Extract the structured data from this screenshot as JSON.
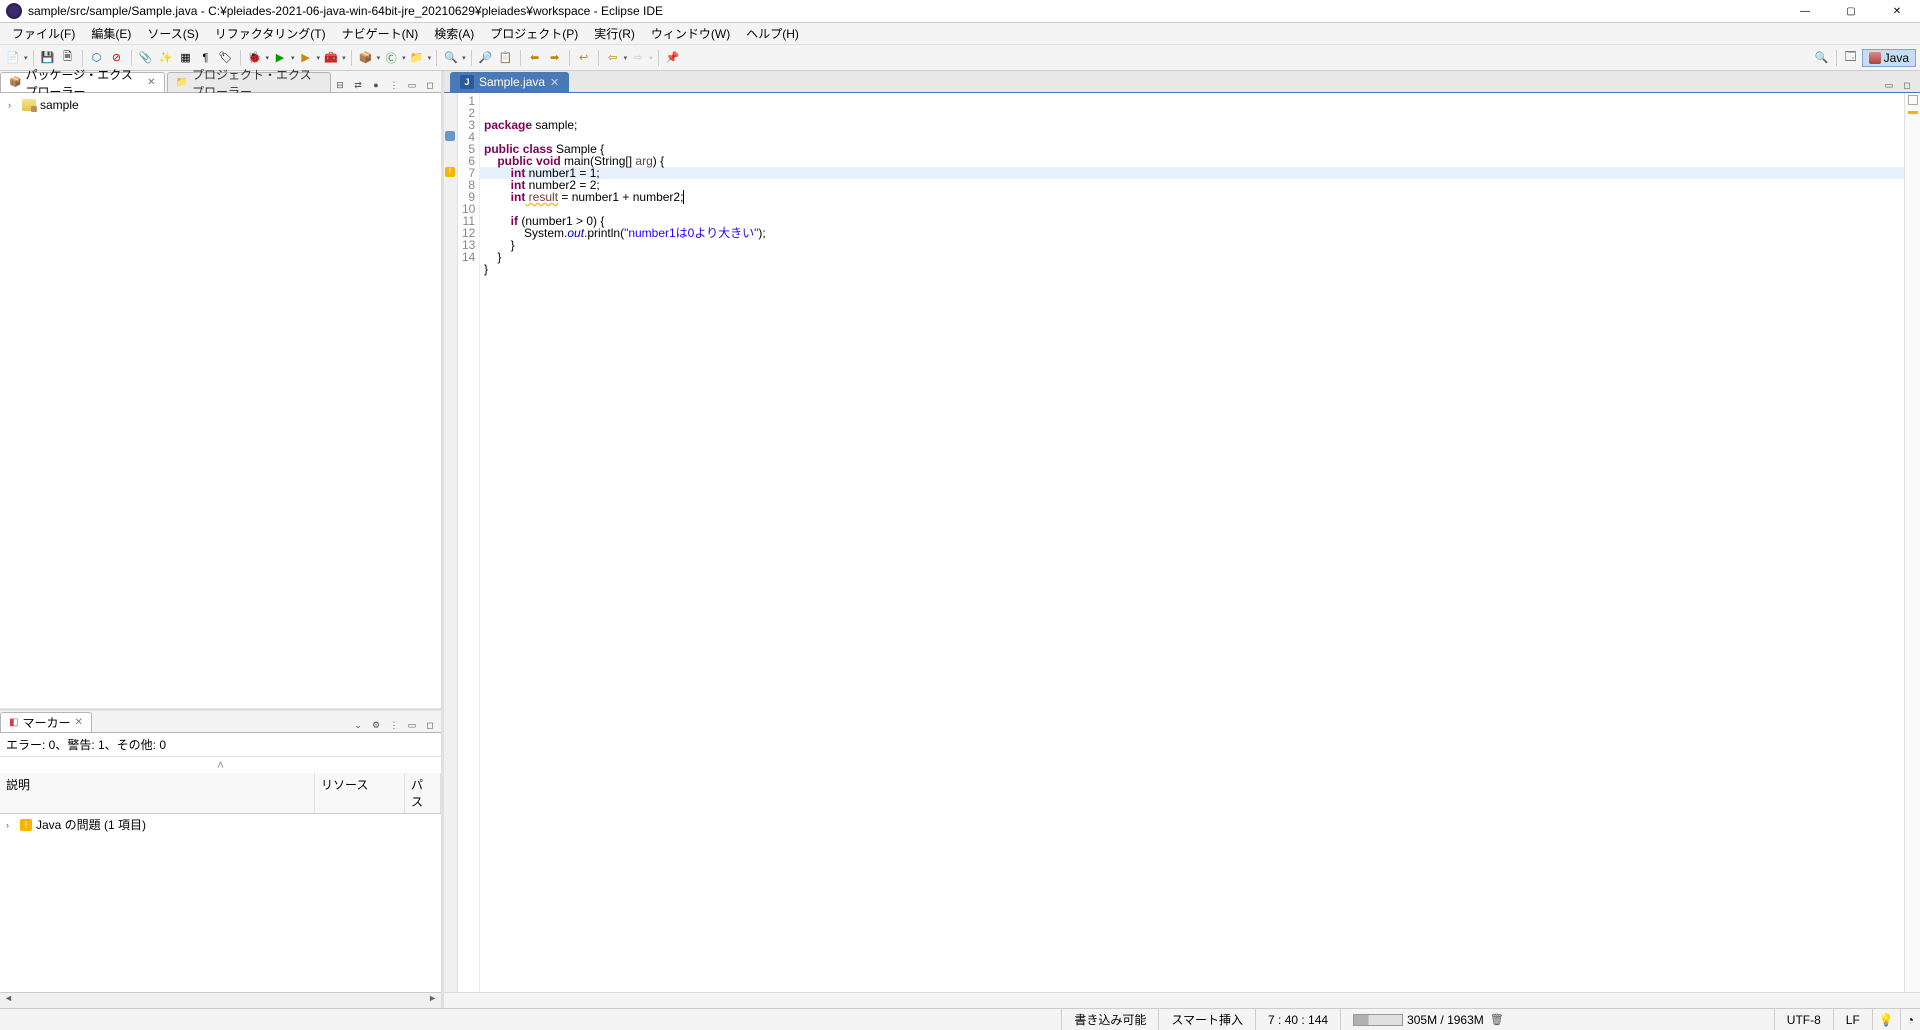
{
  "window": {
    "title": "sample/src/sample/Sample.java - C:¥pleiades-2021-06-java-win-64bit-jre_20210629¥pleiades¥workspace - Eclipse IDE"
  },
  "menu": {
    "file": "ファイル(F)",
    "edit": "編集(E)",
    "source": "ソース(S)",
    "refactor": "リファクタリング(T)",
    "navigate": "ナビゲート(N)",
    "search": "検索(A)",
    "project": "プロジェクト(P)",
    "run": "実行(R)",
    "window": "ウィンドウ(W)",
    "help": "ヘルプ(H)"
  },
  "perspective": {
    "label": "Java"
  },
  "package_explorer": {
    "tab": "パッケージ・エクスプローラー",
    "project_tab": "プロジェクト・エクスプローラー",
    "tree": {
      "root": "sample"
    }
  },
  "markers": {
    "tab": "マーカー",
    "summary": "エラー: 0、警告: 1、その他: 0",
    "columns": {
      "desc": "説明",
      "resource": "リソース",
      "path": "パス"
    },
    "rows": [
      {
        "label": "Java の問題 (1 項目)"
      }
    ]
  },
  "editor": {
    "tab": "Sample.java",
    "line_numbers": [
      "1",
      "2",
      "3",
      "4",
      "5",
      "6",
      "7",
      "8",
      "9",
      "10",
      "11",
      "12",
      "13",
      "14"
    ],
    "code": {
      "l1_kw": "package",
      "l1_rest": " sample;",
      "l3_kw1": "public",
      "l3_kw2": "class",
      "l3_rest": " Sample {",
      "l4_kw1": "public",
      "l4_kw2": "void",
      "l4_m": " main(String[] ",
      "l4_arg": "arg",
      "l4_end": ") {",
      "l5_kw": "int",
      "l5_rest": " number1 = 1;",
      "l6_kw": "int",
      "l6_rest": " number2 = 2;",
      "l7_kw": "int",
      "l7_var": " result",
      "l7_rest": " = number1 + number2;",
      "l9_kw": "if",
      "l9_rest": " (number1 > 0) {",
      "l10_a": "            System.",
      "l10_out": "out",
      "l10_b": ".println(",
      "l10_str": "\"number1は0より大きい\"",
      "l10_c": ");",
      "l11": "        }",
      "l12": "    }",
      "l13": "}"
    }
  },
  "status": {
    "writable": "書き込み可能",
    "insert": "スマート挿入",
    "position": "7 : 40 : 144",
    "memory": "305M / 1963M",
    "encoding": "UTF-8",
    "line_ending": "LF"
  }
}
